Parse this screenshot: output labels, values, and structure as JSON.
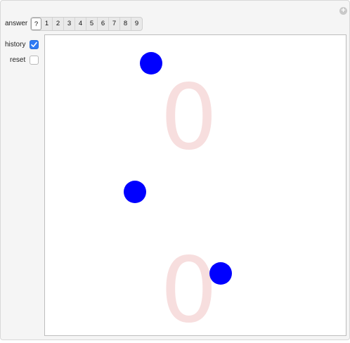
{
  "controls": {
    "answer_label": "answer",
    "answer_options": [
      "?",
      "1",
      "2",
      "3",
      "4",
      "5",
      "6",
      "7",
      "8",
      "9"
    ],
    "answer_selected": "?",
    "history_label": "history",
    "history_checked": true,
    "reset_label": "reset",
    "reset_checked": false,
    "plus_icon": "plus-icon"
  },
  "canvas": {
    "digits": [
      "0",
      "0"
    ],
    "digit_color": "#f7dede",
    "dot_color": "#0000ff"
  }
}
